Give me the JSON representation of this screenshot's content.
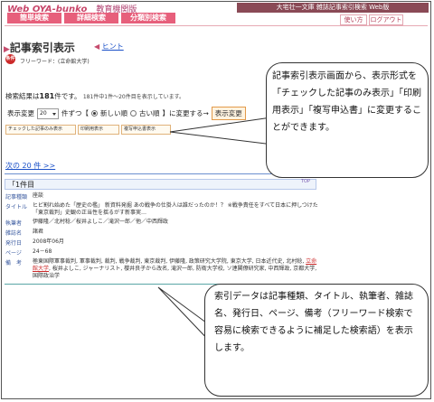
{
  "header": {
    "brand": "Web OYA-bunko",
    "edition": "教育機関版",
    "site_title": "大宅壮一文庫 雑誌記事索引検索 Web版",
    "tabs": [
      "簡単検索",
      "詳細検索",
      "分類別検索"
    ],
    "help_label": "使い方",
    "logout_label": "ログアウト"
  },
  "page": {
    "title": "記事索引表示",
    "hint": "ヒント",
    "condition_badge": "条件",
    "freeword": "フリーワード：(立命館大学)"
  },
  "results": {
    "prefix": "検索結果は",
    "count": "181",
    "suffix": "件です。",
    "detail": "181件中1件〜20件目を表示しています。"
  },
  "sort": {
    "change_label": "表示変更",
    "per_page": "20",
    "per_page_suffix": "件ずつ【",
    "new_label": "新しい順",
    "old_label": "古い順",
    "suffix": "】に変更する→",
    "button": "表示変更"
  },
  "format_buttons": [
    "チェックした記事のみ表示",
    "印刷用表示",
    "複写申込書表示"
  ],
  "next_link": "次の 20 件 >>",
  "record": {
    "number": "「1件目",
    "top": "TOP",
    "fields": [
      {
        "label": "記事種類",
        "value": "座談"
      },
      {
        "label": "タイトル",
        "value": "ヒビ割れ始めた「歴史の檻」 新資料発掘 あの戦争の仕掛人は誰だったのか！？ ※戦争責任をすべて日本に押しつけた「東京裁判」史観の正当性を揺るがす新事実…"
      },
      {
        "label": "執筆者",
        "value": "伊藤隆／北村稔／桜井よしこ／滝沢一郎／他／中西輝政"
      },
      {
        "label": "雑誌名",
        "value": "諸君"
      },
      {
        "label": "発行日",
        "value": "2008年06月"
      },
      {
        "label": "ページ",
        "value": "24－68"
      },
      {
        "label": "備　考",
        "value_before": "極東国際軍事裁判, 軍事裁判, 裁判, 戦争裁判, 東京裁判, 伊藤隆, 政策研究大学院, 東京大学, 日本近代史, 北村稔, ",
        "value_highlight": "立命館大学",
        "value_after": ", 桜井よしこ, ジャーナリスト, 櫻井良子から改名, 滝沢一郎, 防衛大学校, ソ連閣僚研究家, 中西輝政, 京都大学, 国際政治学"
      }
    ]
  },
  "callouts": {
    "top": "記事索引表示画面から、表示形式を「チェックした記事のみ表示」「印刷用表示」「複写申込書」に変更することができます。",
    "bottom": "索引データは記事種類、タイトル、執筆者、雑誌名、発行日、ページ、備考（フリーワード検索で容易に検索できるように補足した検索語）を表示します。"
  }
}
